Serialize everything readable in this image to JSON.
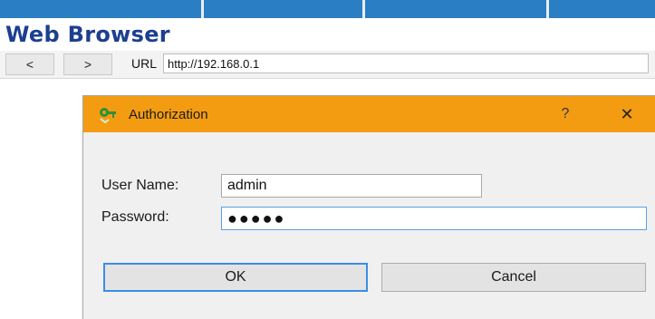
{
  "window": {
    "title": "Web Browser"
  },
  "nav": {
    "back_label": "<",
    "forward_label": ">",
    "url_label": "URL",
    "url_value": "http://192.168.0.1"
  },
  "dialog": {
    "title": "Authorization",
    "help_label": "?",
    "close_label": "✕",
    "username_label": "User Name:",
    "username_value": "admin",
    "password_label": "Password:",
    "password_value": "●●●●●",
    "ok_label": "OK",
    "cancel_label": "Cancel"
  },
  "colors": {
    "title_text": "#1c3f8f",
    "dialog_header": "#f39c12",
    "focus_border": "#3a8ee6"
  },
  "icons": {
    "dialog": "key-icon"
  }
}
